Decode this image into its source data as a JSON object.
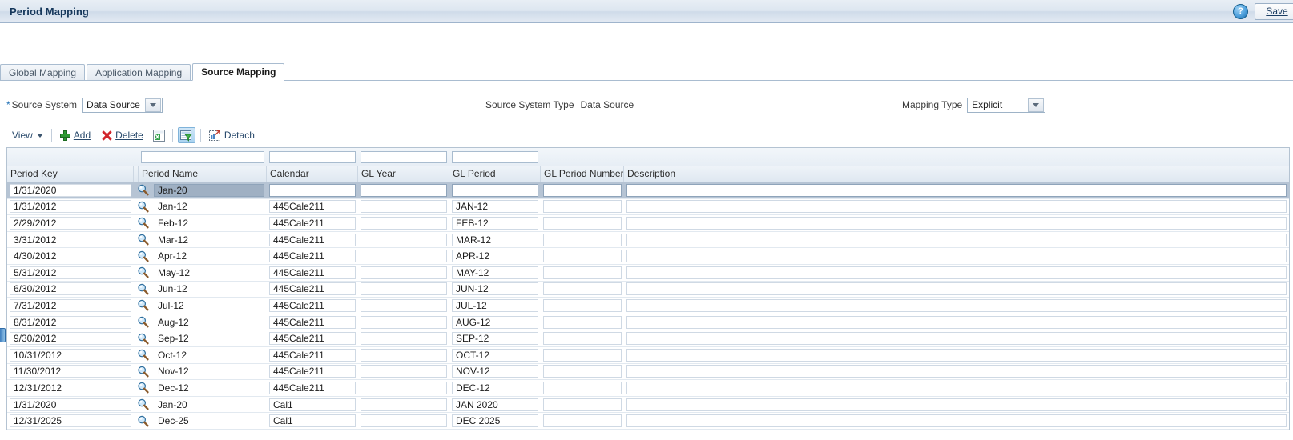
{
  "window": {
    "title": "Period Mapping",
    "help_icon": "help-circle-icon",
    "save_label": "Save"
  },
  "tabs": [
    {
      "label": "Global Mapping",
      "active": false
    },
    {
      "label": "Application Mapping",
      "active": false
    },
    {
      "label": "Source Mapping",
      "active": true
    }
  ],
  "form": {
    "source_system": {
      "required_marker": "*",
      "label": "Source System",
      "value": "Data Source",
      "dropdown_icon": "chevron-down-icon"
    },
    "source_system_type": {
      "label": "Source System Type",
      "value": "Data Source"
    },
    "mapping_type": {
      "label": "Mapping Type",
      "value": "Explicit",
      "dropdown_icon": "chevron-down-icon"
    }
  },
  "toolbar": {
    "view_label": "View",
    "view_caret": "caret-down-icon",
    "add_label": "Add",
    "add_icon": "plus-icon",
    "delete_label": "Delete",
    "delete_icon": "x-delete-icon",
    "export_icon": "export-to-excel-icon",
    "query_icon": "query-by-example-icon",
    "detach_label": "Detach",
    "detach_icon": "detach-icon"
  },
  "table": {
    "columns": [
      {
        "key": "period_key",
        "label": "Period Key"
      },
      {
        "key": "lookup",
        "label": ""
      },
      {
        "key": "period_name",
        "label": "Period Name"
      },
      {
        "key": "calendar",
        "label": "Calendar"
      },
      {
        "key": "gl_year",
        "label": "GL Year"
      },
      {
        "key": "gl_period",
        "label": "GL Period"
      },
      {
        "key": "gl_period_number",
        "label": "GL Period Number"
      },
      {
        "key": "description",
        "label": "Description"
      }
    ],
    "filters": {
      "period_key": "",
      "period_name": "",
      "calendar": "",
      "gl_year": "",
      "gl_period": "",
      "gl_period_number": "",
      "description": ""
    },
    "lookup_icon": "magnifier-icon",
    "rows": [
      {
        "selected": true,
        "period_key": "1/31/2020",
        "period_name": "Jan-20",
        "calendar": "",
        "gl_year": "",
        "gl_period": "",
        "gl_period_number": "",
        "description": ""
      },
      {
        "selected": false,
        "period_key": "1/31/2012",
        "period_name": "Jan-12",
        "calendar": "445Cale211",
        "gl_year": "",
        "gl_period": "JAN-12",
        "gl_period_number": "",
        "description": ""
      },
      {
        "selected": false,
        "period_key": "2/29/2012",
        "period_name": "Feb-12",
        "calendar": "445Cale211",
        "gl_year": "",
        "gl_period": "FEB-12",
        "gl_period_number": "",
        "description": ""
      },
      {
        "selected": false,
        "period_key": "3/31/2012",
        "period_name": "Mar-12",
        "calendar": "445Cale211",
        "gl_year": "",
        "gl_period": "MAR-12",
        "gl_period_number": "",
        "description": ""
      },
      {
        "selected": false,
        "period_key": "4/30/2012",
        "period_name": "Apr-12",
        "calendar": "445Cale211",
        "gl_year": "",
        "gl_period": "APR-12",
        "gl_period_number": "",
        "description": ""
      },
      {
        "selected": false,
        "period_key": "5/31/2012",
        "period_name": "May-12",
        "calendar": "445Cale211",
        "gl_year": "",
        "gl_period": "MAY-12",
        "gl_period_number": "",
        "description": ""
      },
      {
        "selected": false,
        "period_key": "6/30/2012",
        "period_name": "Jun-12",
        "calendar": "445Cale211",
        "gl_year": "",
        "gl_period": "JUN-12",
        "gl_period_number": "",
        "description": ""
      },
      {
        "selected": false,
        "period_key": "7/31/2012",
        "period_name": "Jul-12",
        "calendar": "445Cale211",
        "gl_year": "",
        "gl_period": "JUL-12",
        "gl_period_number": "",
        "description": ""
      },
      {
        "selected": false,
        "period_key": "8/31/2012",
        "period_name": "Aug-12",
        "calendar": "445Cale211",
        "gl_year": "",
        "gl_period": "AUG-12",
        "gl_period_number": "",
        "description": ""
      },
      {
        "selected": false,
        "period_key": "9/30/2012",
        "period_name": "Sep-12",
        "calendar": "445Cale211",
        "gl_year": "",
        "gl_period": "SEP-12",
        "gl_period_number": "",
        "description": ""
      },
      {
        "selected": false,
        "period_key": "10/31/2012",
        "period_name": "Oct-12",
        "calendar": "445Cale211",
        "gl_year": "",
        "gl_period": "OCT-12",
        "gl_period_number": "",
        "description": ""
      },
      {
        "selected": false,
        "period_key": "11/30/2012",
        "period_name": "Nov-12",
        "calendar": "445Cale211",
        "gl_year": "",
        "gl_period": "NOV-12",
        "gl_period_number": "",
        "description": ""
      },
      {
        "selected": false,
        "period_key": "12/31/2012",
        "period_name": "Dec-12",
        "calendar": "445Cale211",
        "gl_year": "",
        "gl_period": "DEC-12",
        "gl_period_number": "",
        "description": ""
      },
      {
        "selected": false,
        "period_key": "1/31/2020",
        "period_name": "Jan-20",
        "calendar": "Cal1",
        "gl_year": "",
        "gl_period": "JAN 2020",
        "gl_period_number": "",
        "description": ""
      },
      {
        "selected": false,
        "period_key": "12/31/2025",
        "period_name": "Dec-25",
        "calendar": "Cal1",
        "gl_year": "",
        "gl_period": "DEC 2025",
        "gl_period_number": "",
        "description": ""
      }
    ]
  },
  "colors": {
    "title_text": "#15375b",
    "selection": "#b6c4d4",
    "accent_blue": "#1f6fb5",
    "add_green": "#2e9a32",
    "delete_red": "#d1252b"
  }
}
